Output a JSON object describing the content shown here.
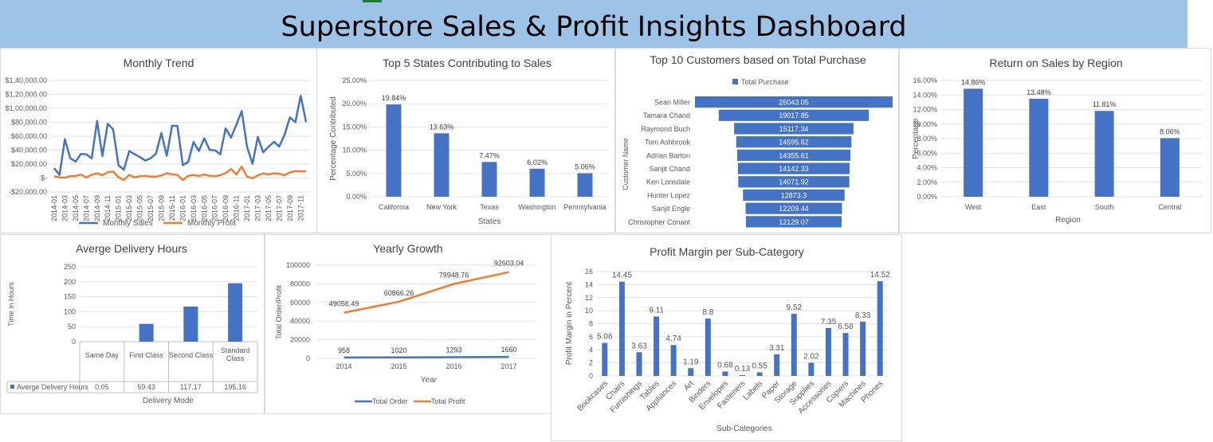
{
  "dashboard_title": "Superstore Sales & Profit Insights Dashboard",
  "colors": {
    "blue": "#4472c4",
    "orange": "#ed7d31",
    "banner": "#9dc3e6",
    "grid": "#d9d9d9"
  },
  "chart_data": [
    {
      "id": "monthly_trend",
      "type": "line",
      "title": "Monthly Trend",
      "x_tick_labels": [
        "2014-01",
        "2014-03",
        "2014-05",
        "2014-07",
        "2014-09",
        "2014-11",
        "2015-01",
        "2015-03",
        "2015-05",
        "2015-07",
        "2015-09",
        "2015-11",
        "2016-01",
        "2016-03",
        "2016-05",
        "2016-07",
        "2016-09",
        "2016-11",
        "2017-01",
        "2017-03",
        "2017-05",
        "2017-07",
        "2017-09",
        "2017-11"
      ],
      "y_tick_labels": [
        "$1,40,000.00",
        "$1,20,000.00",
        "$1,00,000.00",
        "$80,000.00",
        "$60,000.00",
        "$40,000.00",
        "$20,000.00",
        "$-",
        "-$20,000.00"
      ],
      "ylim": [
        -20000,
        140000
      ],
      "series": [
        {
          "name": "Monthly Sales",
          "color": "#4472c4",
          "values": [
            14200,
            4500,
            55700,
            28300,
            23600,
            34600,
            33900,
            28000,
            81800,
            31500,
            78000,
            69500,
            18200,
            11900,
            38700,
            34200,
            30100,
            25000,
            28300,
            34900,
            64600,
            31800,
            75000,
            74700,
            18500,
            22900,
            51700,
            38800,
            56900,
            40300,
            39800,
            34100,
            71200,
            58000,
            76600,
            96000,
            44900,
            20300,
            58900,
            36800,
            44700,
            52000,
            45300,
            62100,
            87000,
            80000,
            118000,
            80400
          ]
        },
        {
          "name": "Monthly Profit",
          "color": "#ed7d31",
          "values": [
            2450,
            860,
            500,
            2800,
            2700,
            4900,
            750,
            4700,
            6800,
            4000,
            8300,
            9200,
            1000,
            -3000,
            4500,
            1000,
            2700,
            3000,
            2000,
            2000,
            3500,
            6900,
            5200,
            4500,
            -3000,
            3000,
            4500,
            2800,
            5000,
            3000,
            2500,
            4000,
            7000,
            12800,
            5100,
            16400,
            2000,
            -500,
            3700,
            6800,
            5000,
            6800,
            6000,
            4000,
            8000,
            10000,
            9500,
            9800
          ]
        }
      ]
    },
    {
      "id": "top5_states",
      "type": "bar",
      "title": "Top 5 States Contributing to Sales",
      "xlabel": "States",
      "ylabel": "Percentage Contributed",
      "categories": [
        "California",
        "New York",
        "Texas",
        "Washington",
        "Pennsylvania"
      ],
      "values": [
        19.84,
        13.63,
        7.47,
        6.02,
        5.06
      ],
      "data_labels": [
        "19.84%",
        "13.63%",
        "7.47%",
        "6.02%",
        "5.06%"
      ],
      "y_tick_labels": [
        "25.00%",
        "20.00%",
        "15.00%",
        "10.00%",
        "5.00%",
        "0.00%"
      ],
      "ylim": [
        0,
        25
      ]
    },
    {
      "id": "top10_customers",
      "type": "bar",
      "title": "Top 10 Customers based on Total Purchase",
      "ylabel": "Customer Name",
      "legend": "Total Purchase",
      "categories": [
        "Sean Miller",
        "Tamara Chand",
        "Raymond Buch",
        "Tom Ashbrook",
        "Adrian Barton",
        "Sanjit Chand",
        "Ken Lonsdale",
        "Hunter Lopez",
        "Sanjit Engle",
        "Christopher Conant"
      ],
      "values": [
        25043.05,
        19017.85,
        15117.34,
        14595.62,
        14355.61,
        14142.33,
        14071.92,
        12873.3,
        12209.44,
        12129.07
      ],
      "data_labels": [
        "25043.05",
        "19017.85",
        "15117.34",
        "14595.62",
        "14355.61",
        "14142.33",
        "14071.92",
        "12873.3",
        "12209.44",
        "12129.07"
      ]
    },
    {
      "id": "return_on_sales",
      "type": "bar",
      "title": "Return on Sales by Region",
      "xlabel": "Region",
      "ylabel": "Percentage",
      "categories": [
        "West",
        "East",
        "South",
        "Central"
      ],
      "values": [
        14.86,
        13.48,
        11.81,
        8.06
      ],
      "data_labels": [
        "14.86%",
        "13.48%",
        "11.81%",
        "8.06%"
      ],
      "y_tick_labels": [
        "16.00%",
        "14.00%",
        "12.00%",
        "10.00%",
        "8.00%",
        "6.00%",
        "4.00%",
        "2.00%",
        "0.00%"
      ],
      "ylim": [
        0,
        16
      ]
    },
    {
      "id": "delivery_hours",
      "type": "bar",
      "title": "Averge Delivery Hours",
      "xlabel": "Delivery Mode",
      "ylabel": "Time in Hours",
      "series_name": "Averge Delivery Hours",
      "categories": [
        "Same Day",
        "First Class",
        "Second Class",
        "Standard Class"
      ],
      "values": [
        0.05,
        59.43,
        117.17,
        195.16
      ],
      "table_values": [
        "0.05",
        "59.43",
        "117.17",
        "195.16"
      ],
      "y_tick_labels": [
        "250",
        "200",
        "150",
        "100",
        "50",
        "0"
      ],
      "ylim": [
        0,
        250
      ]
    },
    {
      "id": "yearly_growth",
      "type": "line",
      "title": "Yearly Growth",
      "xlabel": "Year",
      "ylabel": "Total Order/Profit",
      "categories": [
        "2014",
        "2015",
        "2016",
        "2017"
      ],
      "y_tick_labels": [
        "100000",
        "80000",
        "60000",
        "40000",
        "20000",
        "0"
      ],
      "ylim": [
        0,
        100000
      ],
      "series": [
        {
          "name": "Total Order",
          "color": "#4472c4",
          "values": [
            958,
            1020,
            1293,
            1660
          ],
          "labels": [
            "958",
            "1020",
            "1293",
            "1660"
          ]
        },
        {
          "name": "Total Profit",
          "color": "#ed7d31",
          "values": [
            49056.49,
            60866.26,
            79948.76,
            92603.04
          ],
          "labels": [
            "49056.49",
            "60866.26",
            "79948.76",
            "92603.04"
          ]
        }
      ]
    },
    {
      "id": "profit_margin",
      "type": "bar",
      "title": "Profit Margin per Sub-Category",
      "xlabel": "Sub-Categories",
      "ylabel": "Profit Margin in Percent",
      "categories": [
        "Bookcases",
        "Chairs",
        "Furnishings",
        "Tables",
        "Appliances",
        "Art",
        "Binders",
        "Envelopes",
        "Fasteners",
        "Labels",
        "Paper",
        "Storage",
        "Supplies",
        "Accessories",
        "Copiers",
        "Machines",
        "Phones"
      ],
      "values": [
        5.06,
        14.45,
        3.63,
        9.11,
        4.74,
        1.19,
        8.8,
        0.68,
        0.13,
        0.55,
        3.31,
        9.52,
        2.02,
        7.35,
        6.58,
        8.33,
        14.52
      ],
      "data_labels": [
        "5.06",
        "14.45",
        "3.63",
        "9.11",
        "4.74",
        "1.19",
        "8.8",
        "0.68",
        "0.13",
        "0.55",
        "3.31",
        "9.52",
        "2.02",
        "7.35",
        "6.58",
        "8.33",
        "14.52"
      ],
      "y_tick_labels": [
        "16",
        "14",
        "12",
        "10",
        "8",
        "6",
        "4",
        "2",
        "0"
      ],
      "ylim": [
        0,
        16
      ]
    }
  ]
}
